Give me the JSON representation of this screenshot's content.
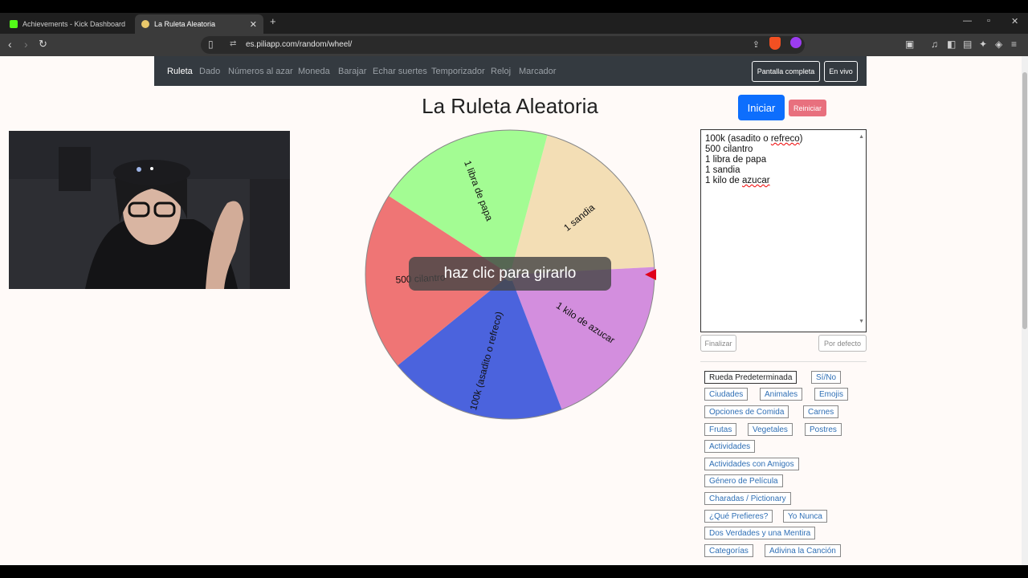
{
  "browser": {
    "tabs": [
      {
        "title": "Achievements - Kick Dashboard",
        "favicon_color": "#53fc18"
      },
      {
        "title": "La Ruleta Aleatoria",
        "favicon_color": "#e9c86b"
      }
    ],
    "new_tab_symbol": "+",
    "url": "es.piliapp.com/random/wheel/",
    "site_info_symbol": "⇄",
    "window_controls": {
      "minimize": "—",
      "maximize": "▫",
      "close": "✕"
    },
    "nav": {
      "back": "‹",
      "forward": "›",
      "reload": "↻"
    }
  },
  "site_nav": {
    "links": [
      {
        "label": "Ruleta",
        "active": true
      },
      {
        "label": "Dado"
      },
      {
        "label": "Números al azar"
      },
      {
        "label": "Moneda"
      },
      {
        "label": "Barajar"
      },
      {
        "label": "Echar suertes"
      },
      {
        "label": "Temporizador"
      },
      {
        "label": "Reloj"
      },
      {
        "label": "Marcador"
      }
    ],
    "fullscreen_label": "Pantalla completa",
    "live_label": "En vivo"
  },
  "page_title": "La Ruleta Aleatoria",
  "start_label": "Iniciar",
  "reset_label": "Reiniciar",
  "overlay_label": "haz clic para girarlo",
  "wheel": {
    "segments": [
      {
        "label": "1 sandia",
        "color": "#f3deb5"
      },
      {
        "label": "1 kilo de azucar",
        "color": "#d38ede"
      },
      {
        "label": "100k (asadito o refreco)",
        "color": "#4b63dd"
      },
      {
        "label": "500 cilantro",
        "color": "#ef7575"
      },
      {
        "label": "1 libra de papa",
        "color": "#a3fc93"
      }
    ],
    "pointer_color": "#e0001b"
  },
  "entries": {
    "lines": [
      {
        "before": "100k (asadito o ",
        "spell": "refreco",
        "after": ")"
      },
      {
        "before": "500 cilantro",
        "spell": "",
        "after": ""
      },
      {
        "before": "1 libra de papa",
        "spell": "",
        "after": ""
      },
      {
        "before": "1 sandia",
        "spell": "",
        "after": ""
      },
      {
        "before": "1 kilo de ",
        "spell": "azucar",
        "after": ""
      }
    ],
    "scroll_up": "▲",
    "scroll_down": "▼"
  },
  "finish_label": "Finalizar",
  "default_label": "Por defecto",
  "presets": [
    "Rueda Predeterminada",
    "Sí/No",
    "Ciudades",
    "Animales",
    "Emojis",
    "Opciones de Comida",
    "Carnes",
    "Frutas",
    "Vegetales",
    "Postres",
    "Actividades",
    "Actividades con Amigos",
    "Género de Película",
    "Charadas / Pictionary",
    "¿Qué Prefieres?",
    "Yo Nunca",
    "Dos Verdades y una Mentira",
    "Categorías",
    "Adivina la Canción"
  ]
}
